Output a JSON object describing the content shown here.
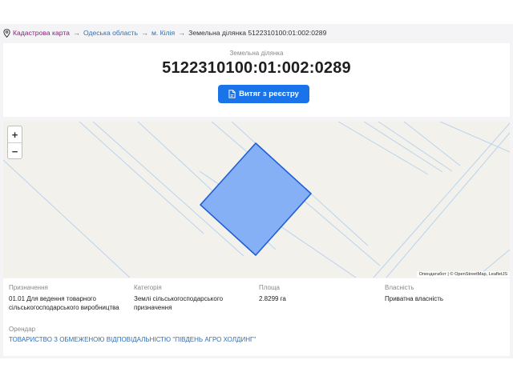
{
  "breadcrumb": {
    "items": [
      "Кадастрова карта",
      "Одеська область",
      "м. Кілія"
    ],
    "separator": "→",
    "current": "Земельна ділянка 5122310100:01:002:0289"
  },
  "header": {
    "subtitle": "Земельна ділянка",
    "title": "5122310100:01:002:0289",
    "button_label": "Витяг з реєстру"
  },
  "map": {
    "zoom_in": "+",
    "zoom_out": "−",
    "attribution": "Опендатабот | © OpenStreetMap, LeafletJS"
  },
  "details": {
    "purpose": {
      "label": "Призначення",
      "value_line1": "01.01 Для ведення товарного",
      "value_line2": "сільськогосподарського виробництва"
    },
    "category": {
      "label": "Категорія",
      "value_line1": "Землі сільськогосподарського",
      "value_line2": "призначення"
    },
    "area": {
      "label": "Площа",
      "value": "2.8299 га"
    },
    "ownership": {
      "label": "Власність",
      "value": "Приватна власність"
    },
    "tenant": {
      "label": "Орендар",
      "value": "ТОВАРИСТВО З ОБМЕЖЕНОЮ ВІДПОВІДАЛЬНІСТЮ \"ПІВДЕНЬ АГРО ХОЛДИНГ\""
    }
  },
  "colors": {
    "accent": "#1a73e8",
    "link": "#2f6fb6",
    "breadcrumb_link": "#8a1f7a",
    "parcel_fill": "#86b0f5",
    "parcel_stroke": "#1f5fd6"
  },
  "icons": {
    "breadcrumb": "map-pin-icon",
    "button": "document-icon"
  }
}
